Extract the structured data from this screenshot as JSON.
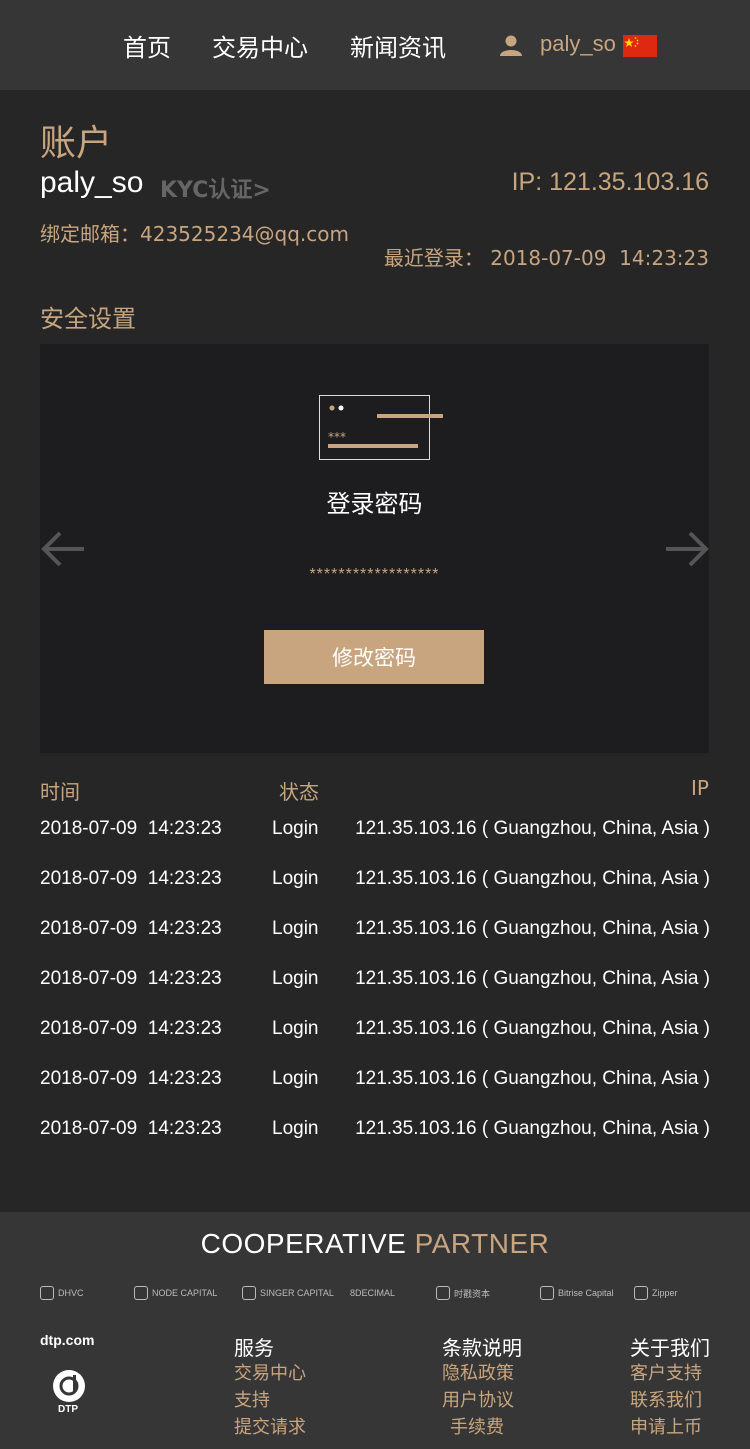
{
  "nav": {
    "items": [
      "首页",
      "交易中心",
      "新闻资讯"
    ],
    "username": "paly_so",
    "icons": {
      "user": "user-icon",
      "flag": "china-flag-icon"
    }
  },
  "account": {
    "title": "账户",
    "username": "paly_so",
    "kyc_link": "KYC认证>",
    "ip": "IP: 121.35.103.16",
    "email_label": "绑定邮箱：",
    "email": "423525234@qq.com",
    "last_login_label": "最近登录：",
    "last_login": "2018-07-09  14:23:23"
  },
  "security": {
    "title": "安全设置",
    "card": {
      "icon": "password-card-icon",
      "label": "登录密码",
      "masked_value": "******************",
      "button": "修改密码"
    },
    "prev_icon": "arrow-left-icon",
    "next_icon": "arrow-right-icon"
  },
  "login_log": {
    "headers": {
      "time": "时间",
      "status": "状态",
      "ip": "IP"
    },
    "rows": [
      {
        "time": "2018-07-09  14:23:23",
        "status": "Login",
        "ip": "121.35.103.16 ( Guangzhou, China, Asia )"
      },
      {
        "time": "2018-07-09  14:23:23",
        "status": "Login",
        "ip": "121.35.103.16 ( Guangzhou, China, Asia )"
      },
      {
        "time": "2018-07-09  14:23:23",
        "status": "Login",
        "ip": "121.35.103.16 ( Guangzhou, China, Asia )"
      },
      {
        "time": "2018-07-09  14:23:23",
        "status": "Login",
        "ip": "121.35.103.16 ( Guangzhou, China, Asia )"
      },
      {
        "time": "2018-07-09  14:23:23",
        "status": "Login",
        "ip": "121.35.103.16 ( Guangzhou, China, Asia )"
      },
      {
        "time": "2018-07-09  14:23:23",
        "status": "Login",
        "ip": "121.35.103.16 ( Guangzhou, China, Asia )"
      },
      {
        "time": "2018-07-09  14:23:23",
        "status": "Login",
        "ip": "121.35.103.16 ( Guangzhou, China, Asia )"
      }
    ]
  },
  "footer": {
    "partner_title_a": "COOPERATIVE",
    "partner_title_b": "PARTNER",
    "partners": [
      "DHVC",
      "NODE CAPITAL",
      "SINGER CAPITAL",
      "8DECIMAL",
      "时戳资本",
      "Bitrise Capital",
      "Zipper"
    ],
    "brand": "dtp.com",
    "brand_sub": "DTP",
    "columns": [
      {
        "title": "服务",
        "items": [
          "交易中心",
          "支持",
          "提交请求"
        ]
      },
      {
        "title": "条款说明",
        "items": [
          "隐私政策",
          "用户协议",
          "手续费"
        ]
      },
      {
        "title": "关于我们",
        "items": [
          "客户支持",
          "联系我们",
          "申请上币"
        ]
      }
    ]
  },
  "colors": {
    "accent": "#c8a57f",
    "bg": "#262626",
    "nav_bg": "#363636",
    "card_bg": "#1d1d1f"
  }
}
